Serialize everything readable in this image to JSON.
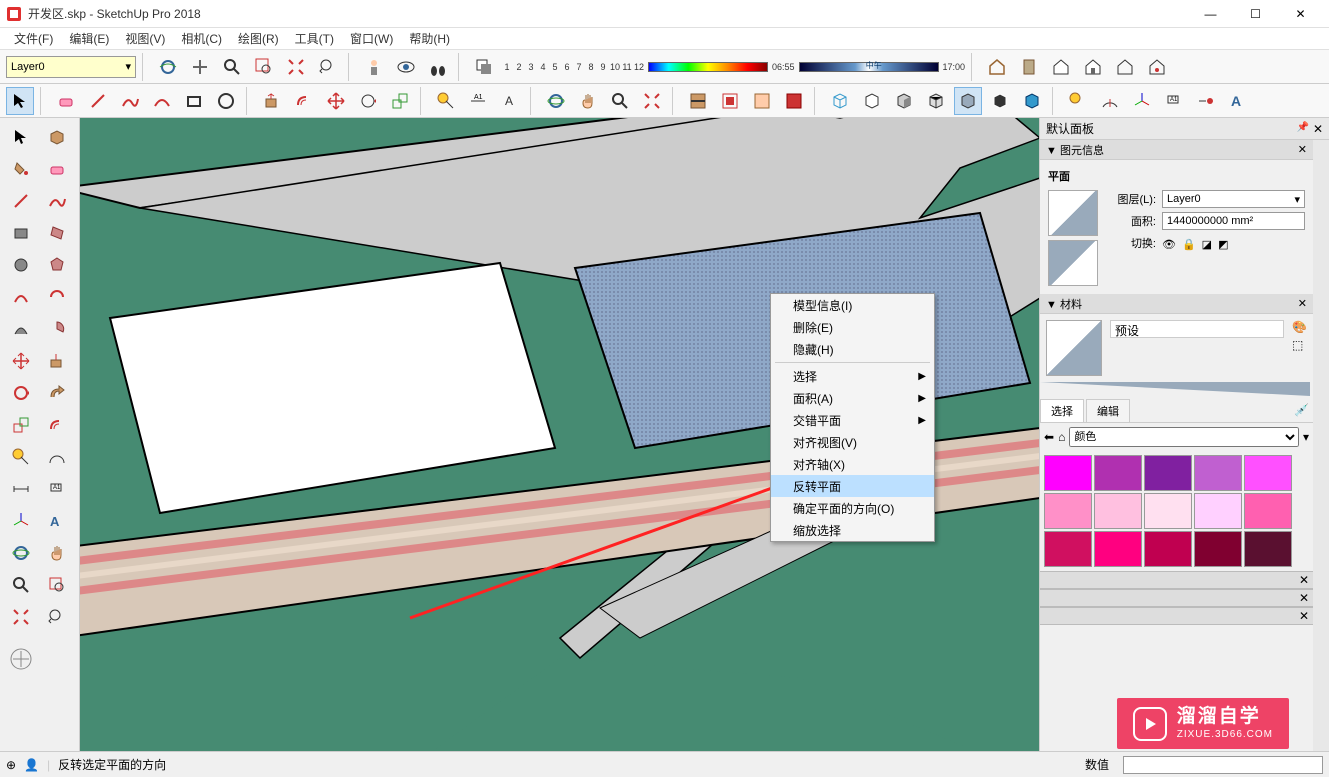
{
  "window": {
    "title": "开发区.skp - SketchUp Pro 2018",
    "min": "—",
    "max": "☐",
    "close": "✕"
  },
  "menus": [
    "文件(F)",
    "编辑(E)",
    "视图(V)",
    "相机(C)",
    "绘图(R)",
    "工具(T)",
    "窗口(W)",
    "帮助(H)"
  ],
  "layer": {
    "current": "Layer0",
    "caret": "▾"
  },
  "shadow": {
    "nums": [
      "1",
      "2",
      "3",
      "4",
      "5",
      "6",
      "7",
      "8",
      "9",
      "10",
      "11",
      "12"
    ],
    "t1": "06:55",
    "mid": "中午",
    "t2": "17:00"
  },
  "context_menu": {
    "items": [
      {
        "label": "模型信息(I)",
        "sub": false
      },
      {
        "label": "删除(E)",
        "sub": false
      },
      {
        "label": "隐藏(H)",
        "sub": false
      },
      {
        "sep": true
      },
      {
        "label": "选择",
        "sub": true
      },
      {
        "label": "面积(A)",
        "sub": true
      },
      {
        "label": "交错平面",
        "sub": true
      },
      {
        "label": "对齐视图(V)",
        "sub": false
      },
      {
        "label": "对齐轴(X)",
        "sub": false
      },
      {
        "label": "反转平面",
        "sub": false,
        "highlighted": true
      },
      {
        "label": "确定平面的方向(O)",
        "sub": false
      },
      {
        "label": "缩放选择",
        "sub": false
      }
    ]
  },
  "panel": {
    "title": "默认面板",
    "entity": {
      "header": "图元信息",
      "type": "平面",
      "layer_label": "图层(L):",
      "layer_value": "Layer0",
      "area_label": "面积:",
      "area_value": "1440000000 mm²",
      "toggle_label": "切换:"
    },
    "material": {
      "header": "材料",
      "preset": "预设",
      "tab_select": "选择",
      "tab_edit": "编辑",
      "category": "颜色",
      "colors": [
        "#ff00ff",
        "#c040c0",
        "#9030b0",
        "#c860d0",
        "#ff40ff",
        "#ff90d0",
        "#ffc0e0",
        "#ffe0f0",
        "#ffd0ff",
        "#ff70c0",
        "#d01060",
        "#ff0080",
        "#e00060",
        "#900040",
        "#601030"
      ]
    }
  },
  "status": {
    "hint": "反转选定平面的方向",
    "value_label": "数值"
  },
  "watermark": {
    "name": "溜溜自学",
    "url": "ZIXUE.3D66.COM"
  }
}
